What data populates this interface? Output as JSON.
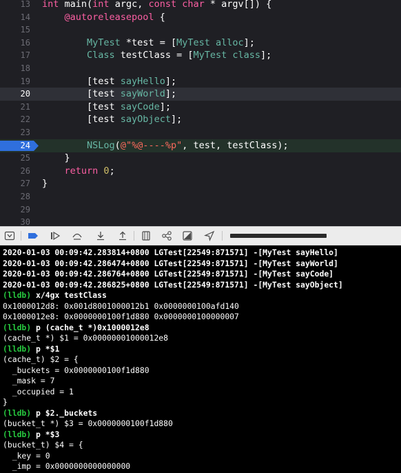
{
  "editor": {
    "lines": [
      {
        "num": "13",
        "segments": [
          {
            "t": "int",
            "c": "kw"
          },
          {
            "t": " main(",
            "c": "plain"
          },
          {
            "t": "int",
            "c": "kw"
          },
          {
            "t": " argc, ",
            "c": "plain"
          },
          {
            "t": "const",
            "c": "kw"
          },
          {
            "t": " ",
            "c": "plain"
          },
          {
            "t": "char",
            "c": "kw"
          },
          {
            "t": " * argv[]) {",
            "c": "plain"
          }
        ]
      },
      {
        "num": "14",
        "segments": [
          {
            "t": "    @autoreleasepool",
            "c": "kw"
          },
          {
            "t": " {",
            "c": "plain"
          }
        ]
      },
      {
        "num": "15",
        "segments": []
      },
      {
        "num": "16",
        "segments": [
          {
            "t": "        MyTest",
            "c": "prop"
          },
          {
            "t": " *test = [",
            "c": "plain"
          },
          {
            "t": "MyTest",
            "c": "prop"
          },
          {
            "t": " ",
            "c": "plain"
          },
          {
            "t": "alloc",
            "c": "prop"
          },
          {
            "t": "];",
            "c": "plain"
          }
        ]
      },
      {
        "num": "17",
        "segments": [
          {
            "t": "        Class",
            "c": "prop"
          },
          {
            "t": " testClass = [",
            "c": "plain"
          },
          {
            "t": "MyTest",
            "c": "prop"
          },
          {
            "t": " ",
            "c": "plain"
          },
          {
            "t": "class",
            "c": "prop"
          },
          {
            "t": "];",
            "c": "plain"
          }
        ]
      },
      {
        "num": "18",
        "segments": []
      },
      {
        "num": "19",
        "segments": [
          {
            "t": "        [test ",
            "c": "plain"
          },
          {
            "t": "sayHello",
            "c": "prop"
          },
          {
            "t": "];",
            "c": "plain"
          }
        ]
      },
      {
        "num": "20",
        "segments": [
          {
            "t": "        [test ",
            "c": "plain"
          },
          {
            "t": "sayWorld",
            "c": "prop"
          },
          {
            "t": "];",
            "c": "plain"
          }
        ],
        "current": true
      },
      {
        "num": "21",
        "segments": [
          {
            "t": "        [test ",
            "c": "plain"
          },
          {
            "t": "sayCode",
            "c": "prop"
          },
          {
            "t": "];",
            "c": "plain"
          }
        ]
      },
      {
        "num": "22",
        "segments": [
          {
            "t": "        [test ",
            "c": "plain"
          },
          {
            "t": "sayObject",
            "c": "prop"
          },
          {
            "t": "];",
            "c": "plain"
          }
        ]
      },
      {
        "num": "23",
        "segments": []
      },
      {
        "num": "24",
        "segments": [
          {
            "t": "        NSLog",
            "c": "prop"
          },
          {
            "t": "(",
            "c": "plain"
          },
          {
            "t": "@\"%@----%p\"",
            "c": "str"
          },
          {
            "t": ", test, testClass);",
            "c": "plain"
          }
        ],
        "breakpoint": true
      },
      {
        "num": "25",
        "segments": [
          {
            "t": "    }",
            "c": "plain"
          }
        ]
      },
      {
        "num": "26",
        "segments": [
          {
            "t": "    return",
            "c": "kw"
          },
          {
            "t": " ",
            "c": "plain"
          },
          {
            "t": "0",
            "c": "num"
          },
          {
            "t": ";",
            "c": "plain"
          }
        ]
      },
      {
        "num": "27",
        "segments": [
          {
            "t": "}",
            "c": "plain"
          }
        ]
      },
      {
        "num": "28",
        "segments": []
      },
      {
        "num": "29",
        "segments": []
      },
      {
        "num": "30",
        "segments": []
      }
    ]
  },
  "debug_bar": {
    "icons": [
      "hide-debug-area-icon",
      "breakpoints-toggle-icon",
      "continue-icon",
      "step-over-icon",
      "step-into-icon",
      "step-out-icon",
      "debug-view-hierarchy-icon",
      "debug-memory-graph-icon",
      "environment-overrides-icon",
      "simulate-location-icon"
    ]
  },
  "console": {
    "lines": [
      {
        "text": "2020-01-03 00:09:42.283814+0800 LGTest[22549:871571] -[MyTest sayHello]",
        "kind": "log"
      },
      {
        "text": "2020-01-03 00:09:42.286474+0800 LGTest[22549:871571] -[MyTest sayWorld]",
        "kind": "log"
      },
      {
        "text": "2020-01-03 00:09:42.286764+0800 LGTest[22549:871571] -[MyTest sayCode]",
        "kind": "log"
      },
      {
        "text": "2020-01-03 00:09:42.286825+0800 LGTest[22549:871571] -[MyTest sayObject]",
        "kind": "log"
      },
      {
        "prompt": "(lldb)",
        "text": " x/4gx testClass",
        "kind": "cmd"
      },
      {
        "text": "0x1000012d8: 0x001d8001000012b1 0x0000000100afd140",
        "kind": "out"
      },
      {
        "text": "0x1000012e8: 0x0000000100f1d880 0x0000000100000007",
        "kind": "out"
      },
      {
        "prompt": "(lldb)",
        "text": " p (cache_t *)0x1000012e8",
        "kind": "cmd"
      },
      {
        "text": "(cache_t *) $1 = 0x00000001000012e8",
        "kind": "out"
      },
      {
        "prompt": "(lldb)",
        "text": " p *$1",
        "kind": "cmd"
      },
      {
        "text": "(cache_t) $2 = {",
        "kind": "out"
      },
      {
        "text": "  _buckets = 0x0000000100f1d880",
        "kind": "out"
      },
      {
        "text": "  _mask = 7",
        "kind": "out"
      },
      {
        "text": "  _occupied = 1",
        "kind": "out"
      },
      {
        "text": "}",
        "kind": "out"
      },
      {
        "prompt": "(lldb)",
        "text": " p $2._buckets",
        "kind": "cmd"
      },
      {
        "text": "(bucket_t *) $3 = 0x0000000100f1d880",
        "kind": "out"
      },
      {
        "prompt": "(lldb)",
        "text": " p *$3",
        "kind": "cmd"
      },
      {
        "text": "(bucket_t) $4 = {",
        "kind": "out"
      },
      {
        "text": "  _key = 0",
        "kind": "out"
      },
      {
        "text": "  _imp = 0x0000000000000000",
        "kind": "out"
      },
      {
        "text": "}",
        "kind": "out"
      }
    ]
  },
  "colors": {
    "editor_bg": "#1f1f24",
    "keyword": "#fc5fa3",
    "class_name": "#67b7a4",
    "string": "#fc6a5d",
    "number": "#d0bf69",
    "breakpoint": "#2f6fdd",
    "lldb_prompt": "#27c93f",
    "console_bg": "#000000"
  }
}
